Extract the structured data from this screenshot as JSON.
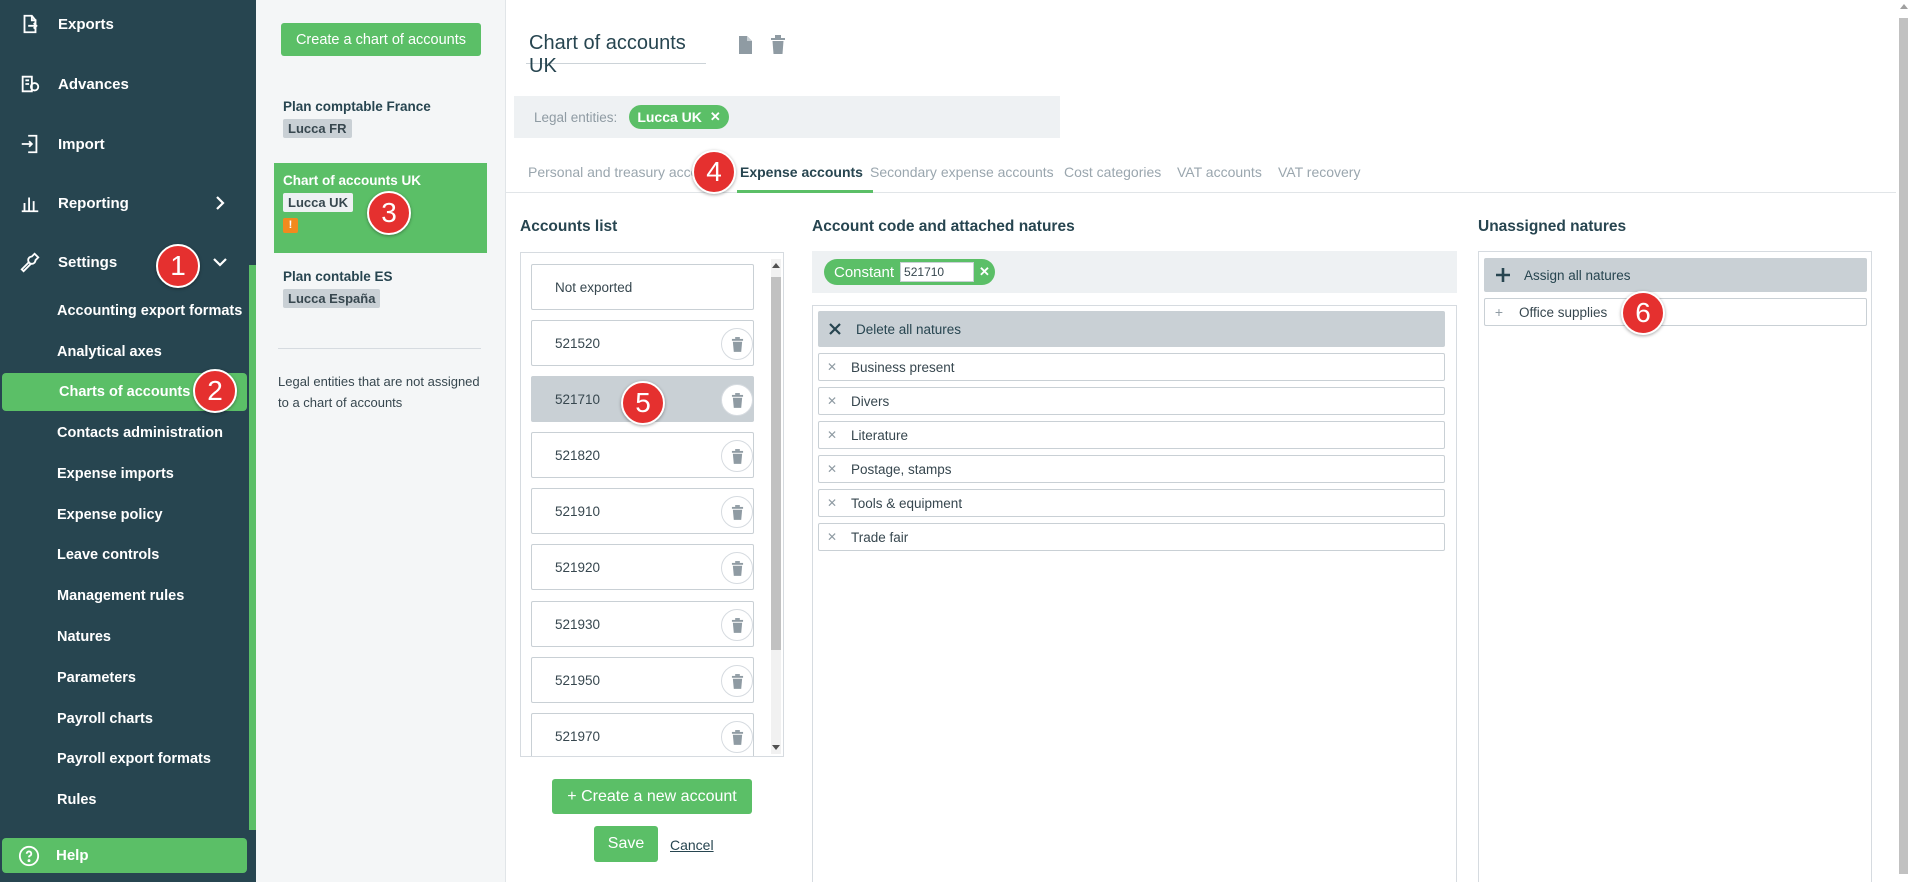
{
  "sidebar": {
    "items": [
      {
        "label": "Exports",
        "icon": "export-icon"
      },
      {
        "label": "Advances",
        "icon": "advances-icon"
      },
      {
        "label": "Import",
        "icon": "import-icon"
      },
      {
        "label": "Reporting",
        "icon": "reporting-icon"
      },
      {
        "label": "Settings",
        "icon": "settings-icon"
      }
    ],
    "settings_sub": [
      "Accounting export formats",
      "Analytical axes",
      "Charts of accounts",
      "Contacts administration",
      "Expense imports",
      "Expense policy",
      "Leave controls",
      "Management rules",
      "Natures",
      "Parameters",
      "Payroll charts",
      "Payroll export formats",
      "Rules"
    ],
    "active_sub": "Charts of accounts",
    "help_label": "Help"
  },
  "charts": {
    "create_label": "Create a chart of accounts",
    "list": [
      {
        "name": "Plan comptable France",
        "entity": "Lucca FR"
      },
      {
        "name": "Chart of accounts UK",
        "entity": "Lucca UK",
        "warning": "!"
      },
      {
        "name": "Plan contable ES",
        "entity": "Lucca España"
      }
    ],
    "unassigned_note": "Legal entities that are not assigned to a chart of accounts"
  },
  "main": {
    "title": "Chart of accounts UK",
    "legal_entities_label": "Legal entities:",
    "legal_entity_chip": "Lucca UK",
    "tabs": [
      "Personal and treasury accounts",
      "Expense accounts",
      "Secondary expense accounts",
      "Cost categories",
      "VAT accounts",
      "VAT recovery"
    ],
    "active_tab": "Expense accounts",
    "accounts_title": "Accounts list",
    "accounts": [
      "Not exported",
      "521520",
      "521710",
      "521820",
      "521910",
      "521920",
      "521930",
      "521950",
      "521970"
    ],
    "selected_account": "521710",
    "new_account_label": "+ Create a new account",
    "save_label": "Save",
    "cancel_label": "Cancel",
    "code_title": "Account code and attached natures",
    "code_chip_label": "Constant",
    "code_value": "521710",
    "delete_all_label": "Delete all natures",
    "attached_natures": [
      "Business present",
      "Divers",
      "Literature",
      "Postage, stamps",
      "Tools & equipment",
      "Trade fair"
    ],
    "unassigned_title": "Unassigned natures",
    "assign_all_label": "Assign all natures",
    "unassigned_natures": [
      "Office supplies"
    ]
  },
  "annotations": [
    "1",
    "2",
    "3",
    "4",
    "5",
    "6"
  ],
  "colors": {
    "sidebar_bg": "#274550",
    "accent_green": "#5bbf67",
    "badge_red": "#e5302f",
    "warning_orange": "#f28a1e",
    "grey_panel": "#eef1f3"
  }
}
